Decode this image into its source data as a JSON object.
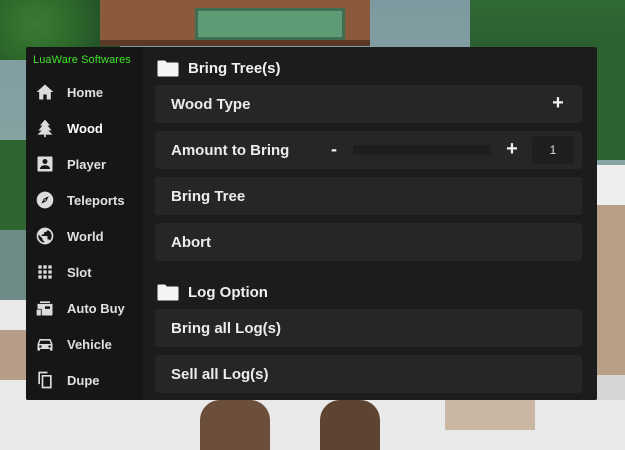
{
  "app": {
    "brand": "LuaWare Softwares",
    "brand_color": "#3fe22a"
  },
  "sidebar": {
    "items": [
      {
        "label": "Home",
        "icon": "home-icon"
      },
      {
        "label": "Wood",
        "icon": "tree-icon",
        "active": true
      },
      {
        "label": "Player",
        "icon": "player-card-icon"
      },
      {
        "label": "Teleports",
        "icon": "compass-icon"
      },
      {
        "label": "World",
        "icon": "globe-icon"
      },
      {
        "label": "Slot",
        "icon": "grid-icon"
      },
      {
        "label": "Auto Buy",
        "icon": "shopping-bag-icon"
      },
      {
        "label": "Vehicle",
        "icon": "car-icon"
      },
      {
        "label": "Dupe",
        "icon": "copy-icon"
      }
    ]
  },
  "main": {
    "sections": [
      {
        "title": "Bring Tree(s)",
        "icon": "folder-icon",
        "controls": [
          {
            "label": "Wood Type",
            "type": "dropdown",
            "expand_symbol": "+"
          },
          {
            "label": "Amount to Bring",
            "type": "slider",
            "minus_symbol": "-",
            "plus_symbol": "+",
            "value": "1"
          },
          {
            "label": "Bring Tree",
            "type": "button"
          },
          {
            "label": "Abort",
            "type": "button"
          }
        ]
      },
      {
        "title": "Log Option",
        "icon": "folder-icon",
        "controls": [
          {
            "label": "Bring all Log(s)",
            "type": "button"
          },
          {
            "label": "Sell all Log(s)",
            "type": "button"
          }
        ]
      }
    ]
  }
}
